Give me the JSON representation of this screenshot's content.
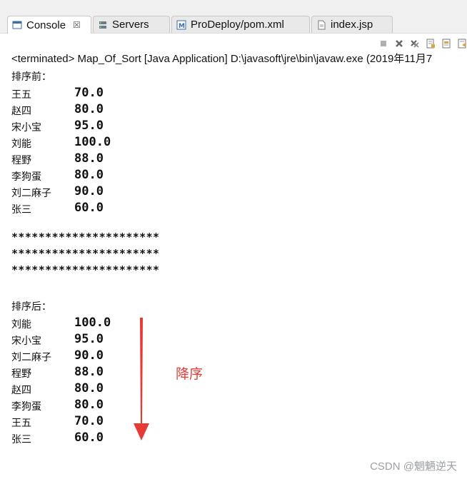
{
  "tabs": [
    {
      "label": "Console",
      "close": "☒",
      "icon": "console-icon"
    },
    {
      "label": "Servers",
      "icon": "servers-icon"
    },
    {
      "label": "ProDeploy/pom.xml",
      "icon": "maven-pom-icon"
    },
    {
      "label": "index.jsp",
      "icon": "jsp-file-icon"
    }
  ],
  "toolbar": {
    "icons": [
      "terminate-icon",
      "remove-launch-icon",
      "remove-all-terminated-icon",
      "scroll-lock-icon",
      "word-wrap-icon",
      "clear-console-icon"
    ]
  },
  "status": "<terminated> Map_Of_Sort [Java Application] D:\\javasoft\\jre\\bin\\javaw.exe (2019年11月7",
  "before": {
    "header": "排序前：",
    "rows": [
      {
        "name": "王五",
        "score": "70.0"
      },
      {
        "name": "赵四",
        "score": "80.0"
      },
      {
        "name": "宋小宝",
        "score": "95.0"
      },
      {
        "name": "刘能",
        "score": "100.0"
      },
      {
        "name": "程野",
        "score": "88.0"
      },
      {
        "name": "李狗蛋",
        "score": "80.0"
      },
      {
        "name": "刘二麻子",
        "score": "90.0"
      },
      {
        "name": "张三",
        "score": "60.0"
      }
    ]
  },
  "separator": [
    "**********************",
    "**********************",
    "**********************"
  ],
  "after": {
    "header": "排序后：",
    "rows": [
      {
        "name": "刘能",
        "score": "100.0"
      },
      {
        "name": "宋小宝",
        "score": "95.0"
      },
      {
        "name": "刘二麻子",
        "score": "90.0"
      },
      {
        "name": "程野",
        "score": "88.0"
      },
      {
        "name": "赵四",
        "score": "80.0"
      },
      {
        "name": "李狗蛋",
        "score": "80.0"
      },
      {
        "name": "王五",
        "score": "70.0"
      },
      {
        "name": "张三",
        "score": "60.0"
      }
    ]
  },
  "annotation": {
    "label": "降序",
    "color": "#e63a36"
  },
  "watermark": "CSDN @魍魉逆天"
}
